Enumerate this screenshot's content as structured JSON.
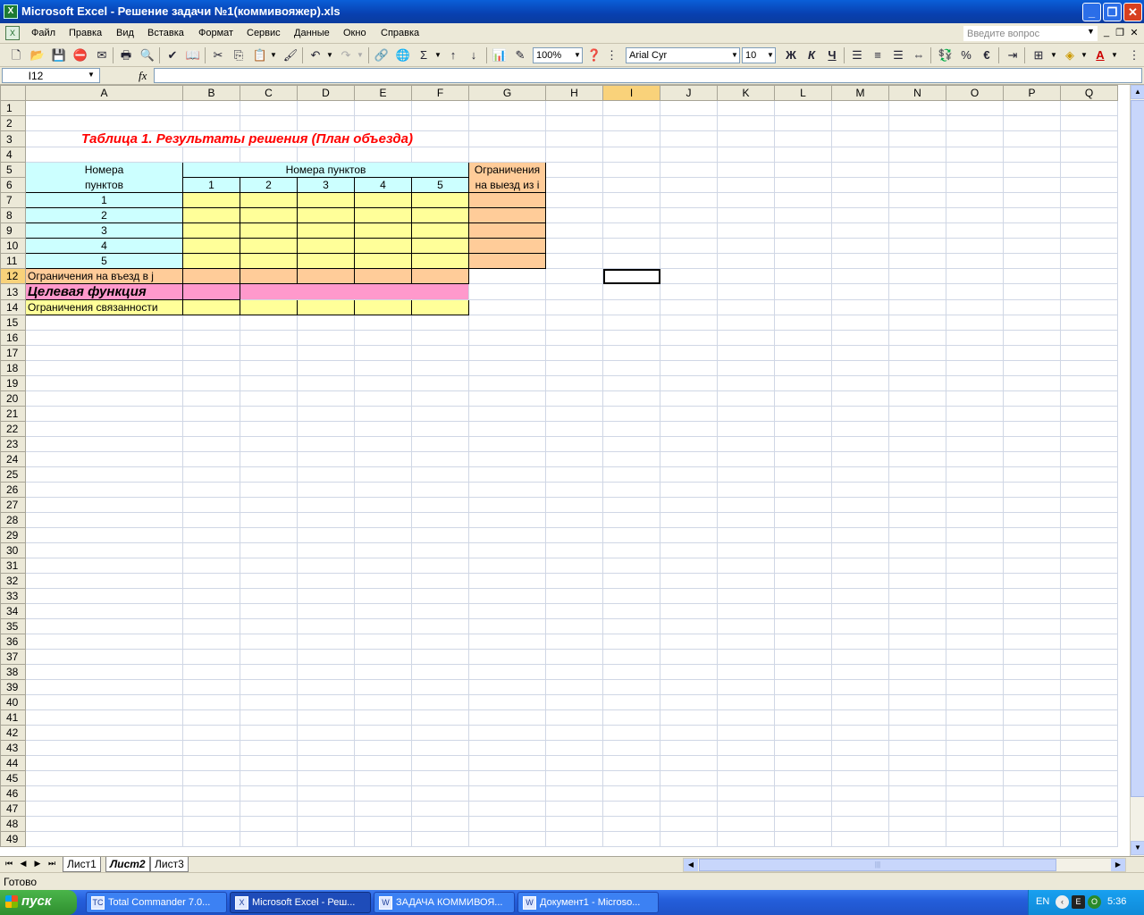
{
  "window": {
    "title": "Microsoft Excel - Решение задачи №1(коммивояжер).xls"
  },
  "menu": {
    "items": [
      "Файл",
      "Правка",
      "Вид",
      "Вставка",
      "Формат",
      "Сервис",
      "Данные",
      "Окно",
      "Справка"
    ],
    "help_placeholder": "Введите вопрос"
  },
  "toolbar": {
    "zoom": "100%",
    "font": "Arial Cyr",
    "size": "10",
    "bold": "Ж",
    "italic": "К",
    "underline": "Ч",
    "percent": "%",
    "euro": "€"
  },
  "formula_bar": {
    "name_box": "I12",
    "fx": "fx",
    "formula": ""
  },
  "columns": [
    "A",
    "B",
    "C",
    "D",
    "E",
    "F",
    "G",
    "H",
    "I",
    "J",
    "K",
    "L",
    "M",
    "N",
    "O",
    "P",
    "Q"
  ],
  "selected": {
    "column": "I",
    "row": 12
  },
  "sheet": {
    "title": "Таблица 1. Результаты решения (План объезда)",
    "row_header_label_1": "Номера",
    "row_header_label_2": "пунктов",
    "col_group_label": "Номера пунктов",
    "col_numbers": [
      "1",
      "2",
      "3",
      "4",
      "5"
    ],
    "row_numbers": [
      "1",
      "2",
      "3",
      "4",
      "5"
    ],
    "exit_limit_1": "Ограничения",
    "exit_limit_2": "на выезд из i",
    "entry_limit": "Ограничения на въезд в j",
    "goal": "Целевая функция",
    "connectivity": "Ограничения связанности"
  },
  "tabs": [
    "Лист1",
    "Лист2",
    "Лист3"
  ],
  "active_tab": "Лист2",
  "status": "Готово",
  "taskbar": {
    "start": "пуск",
    "tasks": [
      "Total Commander 7.0...",
      "Microsoft Excel - Реш...",
      "ЗАДАЧА КОММИВОЯ...",
      "Документ1 - Microso..."
    ],
    "lang": "EN",
    "clock": "5:36"
  },
  "colors": {
    "cyan": "#ccffff",
    "yellow": "#ffff99",
    "orange": "#ffcc99",
    "pink": "#ff99cc",
    "title_red": "#ff0000"
  }
}
